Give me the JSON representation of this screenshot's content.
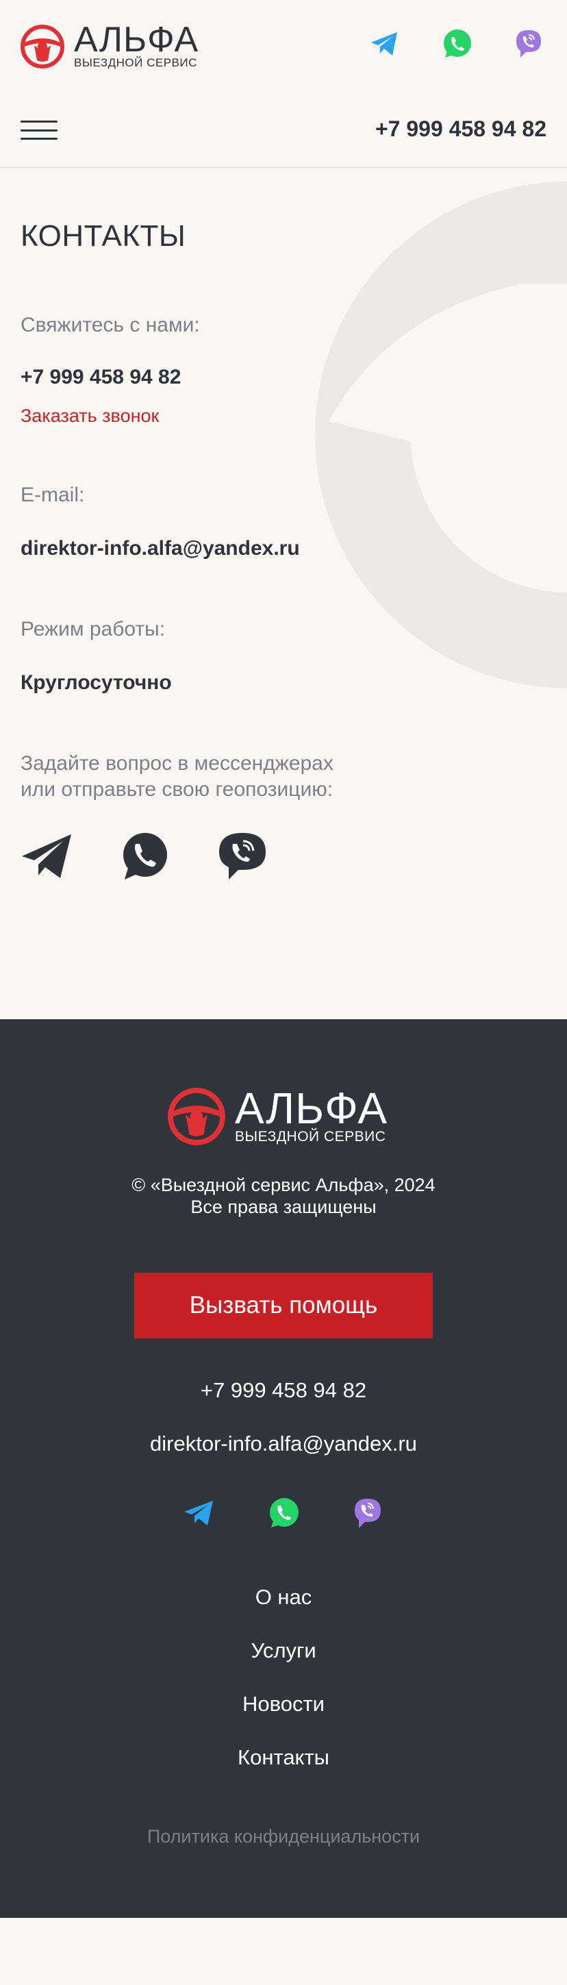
{
  "header": {
    "brand_title": "АЛЬФА",
    "brand_subtitle": "ВЫЕЗДНОЙ СЕРВИС",
    "phone": "+7 999 458 94 82",
    "messengers": [
      "telegram-icon",
      "whatsapp-icon",
      "viber-icon"
    ]
  },
  "contacts": {
    "title": "КОНТАКТЫ",
    "contact_label": "Свяжитесь с нами:",
    "phone": "+7 999 458 94 82",
    "call_link": "Заказать звонок",
    "email_label": "E-mail:",
    "email": "direktor-info.alfa@yandex.ru",
    "hours_label": "Режим работы:",
    "hours": "Круглосуточно",
    "ask_line1": "Задайте вопрос в мессенджерах",
    "ask_line2": "или отправьте свою геопозицию:"
  },
  "footer": {
    "brand_title": "АЛЬФА",
    "brand_subtitle": "ВЫЕЗДНОЙ СЕРВИС",
    "copyright": "© «Выездной сервис Альфа», 2024",
    "rights": "Все права защищены",
    "cta": "Вызвать помощь",
    "phone": "+7 999 458 94 82",
    "email": "direktor-info.alfa@yandex.ru",
    "nav": [
      "О нас",
      "Услуги",
      "Новости",
      "Контакты"
    ],
    "policy": "Политика конфиденциальности"
  },
  "colors": {
    "accent": "#c72126",
    "dark": "#30353b",
    "background": "#f9f6f3",
    "telegram": "#2aa3ee",
    "whatsapp": "#25d366",
    "viber": "#9e77e0"
  }
}
